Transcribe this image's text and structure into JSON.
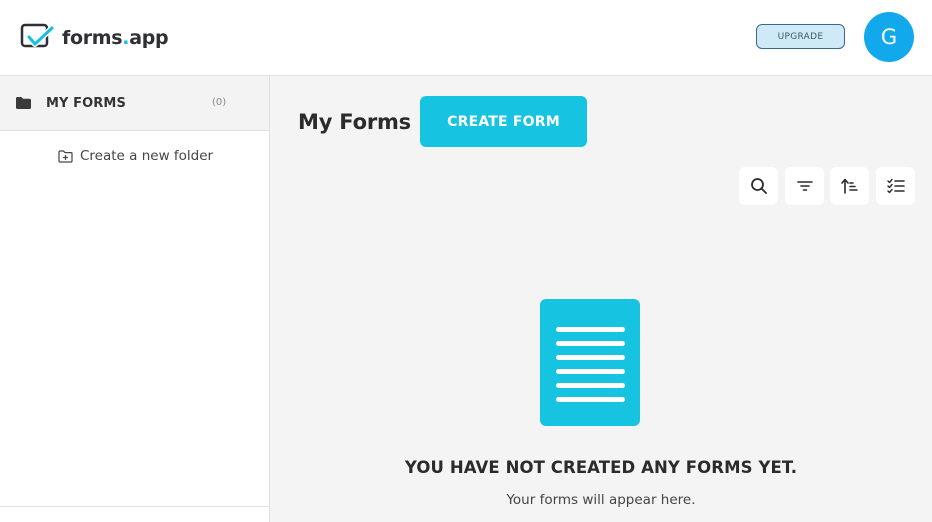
{
  "header": {
    "logo_text": "forms",
    "logo_dot": ".",
    "logo_suffix": "app",
    "upgrade_label": "UPGRADE",
    "avatar_initial": "G",
    "accent_color": "#12c3e0",
    "avatar_color": "#11a8ec"
  },
  "sidebar": {
    "my_forms_label": "MY FORMS",
    "my_forms_count": "(0)",
    "new_folder_label": "Create a new folder",
    "icons": [
      "folder-icon",
      "folder-plus-icon"
    ]
  },
  "main": {
    "title": "My Forms",
    "create_label": "CREATE FORM",
    "toolbar": [
      "search-icon",
      "filter-icon",
      "sort-icon",
      "select-list-icon"
    ],
    "empty_title": "YOU HAVE NOT CREATED ANY FORMS YET.",
    "empty_subtitle": "Your forms will appear here."
  }
}
